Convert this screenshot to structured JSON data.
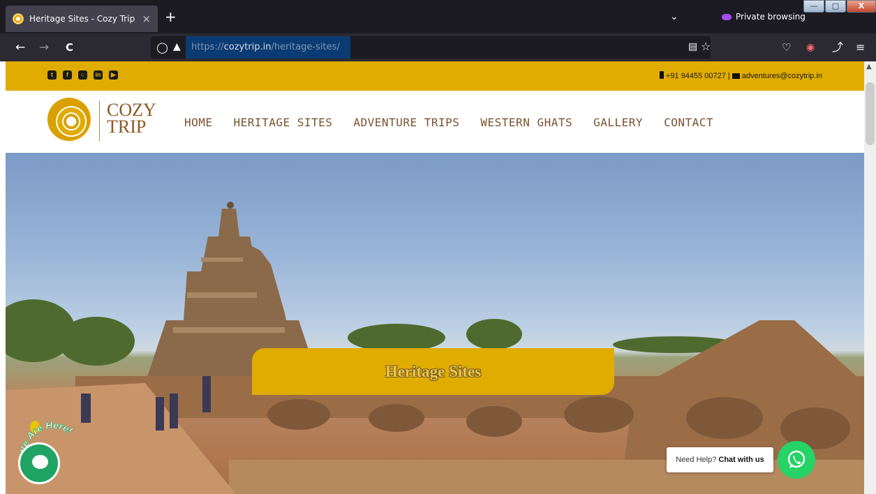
{
  "browser": {
    "tab_title": "Heritage Sites - Cozy Trip",
    "tab_close": "×",
    "new_tab": "+",
    "private_label": "Private browsing",
    "url_domain": "cozytrip.in",
    "url_prefix": "https://",
    "url_path": "/heritage-sites/",
    "back": "←",
    "forward": "→",
    "reload": "C"
  },
  "topbar": {
    "phone": "+91 94455 00727",
    "separator": "|",
    "email": "adventures@cozytrip.in",
    "social": [
      "twitter-icon",
      "facebook-icon",
      "instagram-icon",
      "linkedin-icon",
      "youtube-icon"
    ]
  },
  "brand": {
    "line1": "COZY",
    "line2": "TRIP"
  },
  "nav": [
    {
      "label": "HOME"
    },
    {
      "label": "HERITAGE SITES"
    },
    {
      "label": "ADVENTURE TRIPS"
    },
    {
      "label": "WESTERN GHATS"
    },
    {
      "label": "GALLERY"
    },
    {
      "label": "CONTACT"
    }
  ],
  "hero": {
    "banner_title": "Heritage Sites"
  },
  "widgets": {
    "we_are_here": "We Are Here!",
    "need_help": "Need Help?",
    "chat_with_us": "Chat with us"
  },
  "colors": {
    "accent": "#e0ac00",
    "brand_text": "#7a5230",
    "whatsapp": "#25d366",
    "chat": "#1fa463"
  }
}
